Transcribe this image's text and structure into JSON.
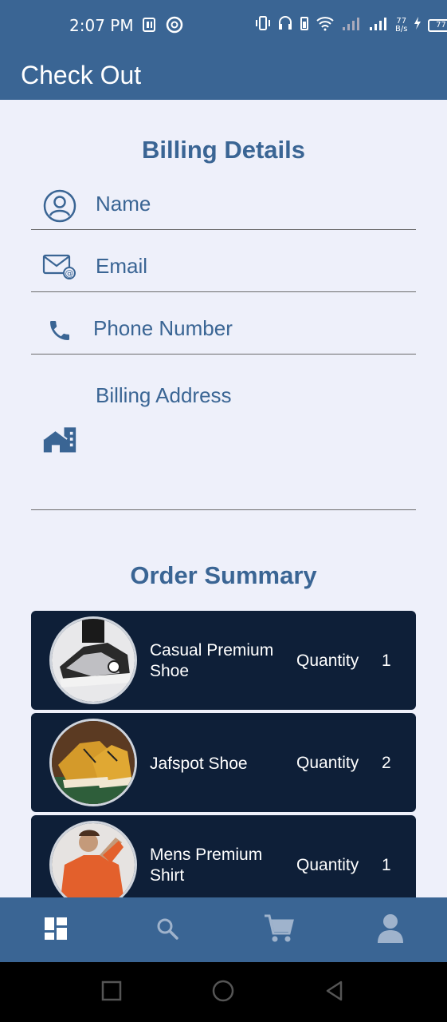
{
  "status_bar": {
    "time": "2:07 PM",
    "net_speed_top": "77",
    "net_speed_bottom": "B/s",
    "battery": "77"
  },
  "app_bar": {
    "title": "Check Out"
  },
  "billing": {
    "title": "Billing Details",
    "fields": [
      {
        "label": "Name",
        "icon": "person-icon"
      },
      {
        "label": "Email",
        "icon": "email-icon"
      },
      {
        "label": "Phone Number",
        "icon": "phone-icon"
      },
      {
        "label": "Billing Address",
        "icon": "home-icon"
      }
    ]
  },
  "order_summary": {
    "title": "Order Summary",
    "items": [
      {
        "name": "Casual Premium Shoe",
        "quantity_label": "Quantity",
        "quantity": "1"
      },
      {
        "name": "Jafspot Shoe",
        "quantity_label": "Quantity",
        "quantity": "2"
      },
      {
        "name": "Mens Premium Shirt",
        "quantity_label": "Quantity",
        "quantity": "1"
      }
    ]
  },
  "bottom_nav": {
    "items": [
      {
        "icon": "dashboard-icon",
        "active": true
      },
      {
        "icon": "search-icon",
        "active": false
      },
      {
        "icon": "cart-icon",
        "active": false
      },
      {
        "icon": "profile-icon",
        "active": false
      }
    ]
  },
  "colors": {
    "primary": "#3a6594",
    "background": "#eef0fa",
    "card": "#0e1f38"
  }
}
